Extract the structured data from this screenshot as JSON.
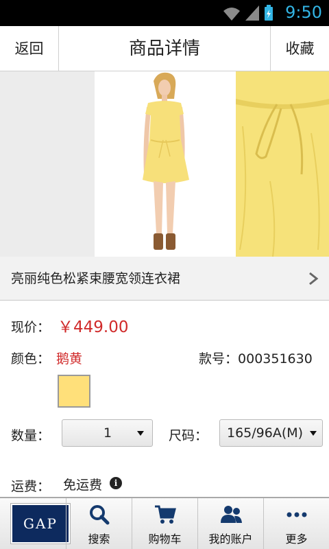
{
  "status_bar": {
    "time": "9:50"
  },
  "header": {
    "back_label": "返回",
    "title": "商品详情",
    "favorite_label": "收藏"
  },
  "product": {
    "name": "亮丽纯色松紧束腰宽领连衣裙",
    "price_label": "现价：",
    "price": "￥449.00",
    "color_label": "颜色：",
    "color_value": "鹅黄",
    "swatch_color": "#ffe07a",
    "sku_label": "款号：",
    "sku_value": "000351630",
    "quantity_label": "数量：",
    "quantity_value": "1",
    "size_label": "尺码：",
    "size_value": "165/96A(M)",
    "shipping_label": "运费：",
    "shipping_value": "免运费"
  },
  "tabs": {
    "logo_text": "GAP",
    "search": "搜索",
    "cart": "购物车",
    "account": "我的账户",
    "more": "更多"
  },
  "colors": {
    "accent": "#33b5e5",
    "price": "#d02a2a",
    "logo_bg": "#0d2a5e"
  }
}
